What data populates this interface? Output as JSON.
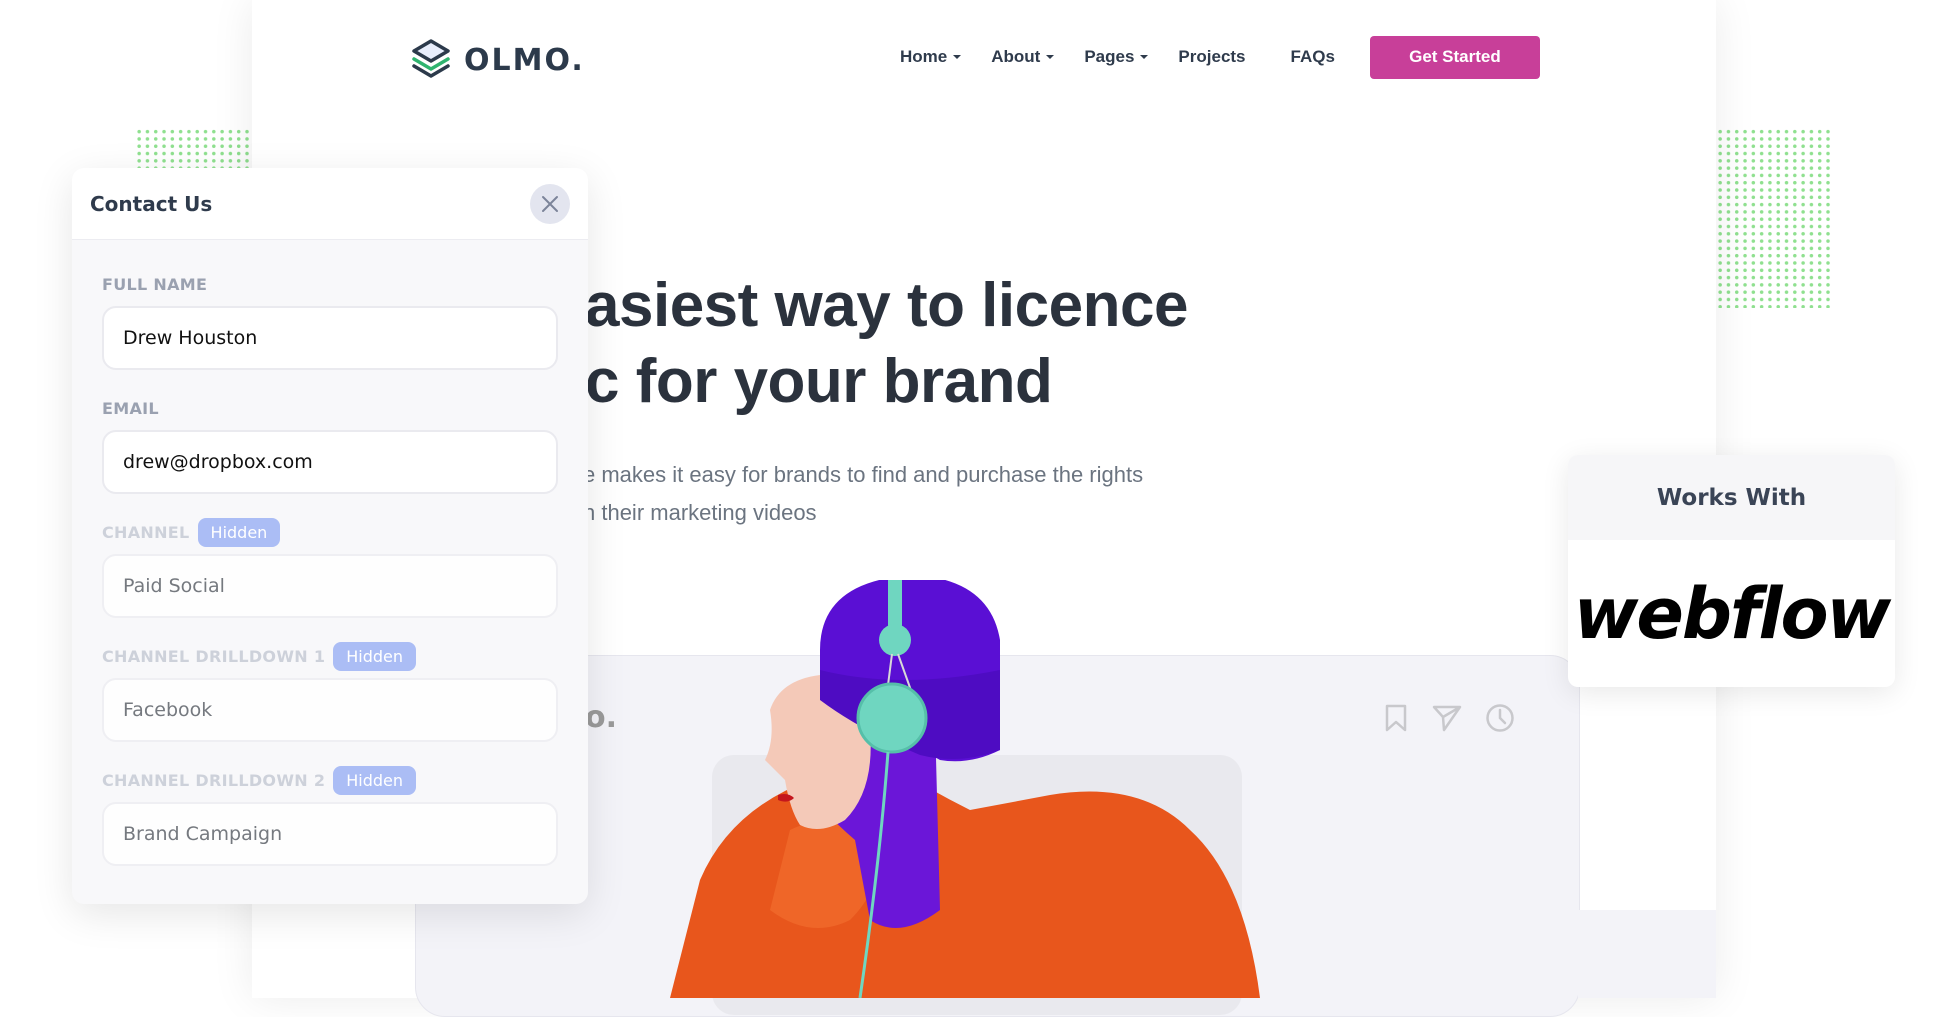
{
  "brand": {
    "name": "OLMO.",
    "accent": "#c83f99"
  },
  "nav": {
    "items": [
      {
        "label": "Home",
        "dropdown": true
      },
      {
        "label": "About",
        "dropdown": true
      },
      {
        "label": "Pages",
        "dropdown": true
      },
      {
        "label": "Projects",
        "dropdown": false
      },
      {
        "label": "FAQs",
        "dropdown": false
      }
    ],
    "cta_label": "Get Started"
  },
  "hero": {
    "title_line1": "asiest way to licence",
    "title_line2": "c for your brand",
    "subtitle_line1": "e makes it easy for brands to find and purchase the rights",
    "subtitle_line2": "n their marketing videos"
  },
  "mockup": {
    "logo_fragment": "o.",
    "icons": [
      "bookmark-icon",
      "send-icon",
      "clock-icon"
    ]
  },
  "contact": {
    "title": "Contact Us",
    "close_icon": "close-icon",
    "fields": [
      {
        "label": "FULL NAME",
        "value": "Drew Houston",
        "hidden": false
      },
      {
        "label": "EMAIL",
        "value": "drew@dropbox.com",
        "hidden": false
      },
      {
        "label": "CHANNEL",
        "value": "Paid Social",
        "hidden": true,
        "badge": "Hidden"
      },
      {
        "label": "CHANNEL DRILLDOWN 1",
        "value": "Facebook",
        "hidden": true,
        "badge": "Hidden"
      },
      {
        "label": "CHANNEL DRILLDOWN 2",
        "value": "Brand Campaign",
        "hidden": true,
        "badge": "Hidden"
      }
    ]
  },
  "works_with": {
    "title": "Works With",
    "logo": "webflow"
  }
}
